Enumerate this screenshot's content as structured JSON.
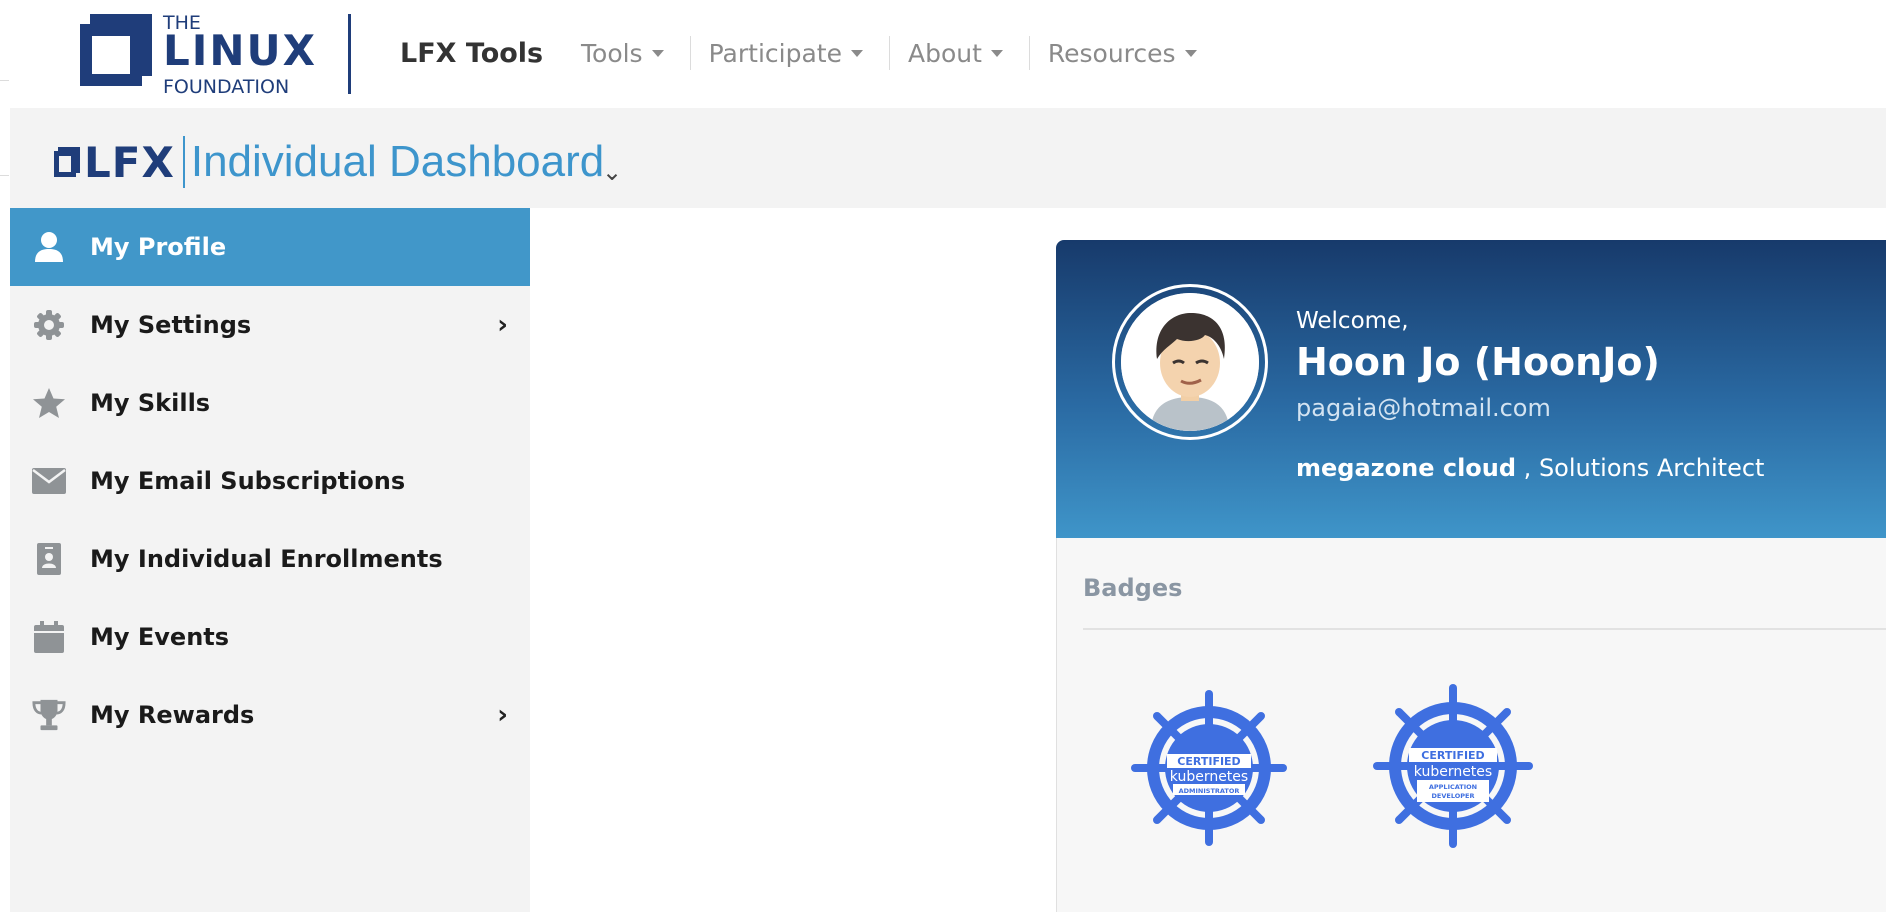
{
  "topnav": {
    "logo": {
      "the": "THE",
      "linux": "LINUX",
      "foundation": "FOUNDATION"
    },
    "product": "LFX Tools",
    "items": [
      {
        "label": "Tools"
      },
      {
        "label": "Participate"
      },
      {
        "label": "About"
      },
      {
        "label": "Resources"
      }
    ]
  },
  "subheader": {
    "brand": "LFX",
    "title": "Individual Dashboard",
    "chevron": "⌄"
  },
  "sidebar": {
    "items": [
      {
        "label": "My Profile",
        "icon": "user-icon",
        "active": true
      },
      {
        "label": "My Settings",
        "icon": "gear-icon",
        "submenu": true
      },
      {
        "label": "My Skills",
        "icon": "star-icon"
      },
      {
        "label": "My Email Subscriptions",
        "icon": "envelope-icon"
      },
      {
        "label": "My Individual Enrollments",
        "icon": "id-badge-icon"
      },
      {
        "label": "My Events",
        "icon": "calendar-icon"
      },
      {
        "label": "My Rewards",
        "icon": "trophy-icon",
        "submenu": true
      }
    ],
    "arrow": "›"
  },
  "profile": {
    "welcome": "Welcome,",
    "name": "Hoon Jo (HoonJo)",
    "email": "pagaia@hotmail.com",
    "organization": "megazone cloud",
    "title_sep": " , ",
    "job_title": "Solutions Architect"
  },
  "badges": {
    "title": "Badges",
    "items": [
      {
        "line1": "CERTIFIED",
        "line2": "kubernetes",
        "line3": "ADMINISTRATOR"
      },
      {
        "line1": "CERTIFIED",
        "line2": "kubernetes",
        "line3": "APPLICATION",
        "line4": "DEVELOPER"
      }
    ]
  },
  "colors": {
    "accent": "#4197c9",
    "brand_navy": "#1f3d7a",
    "badge_blue": "#3f6fe0"
  }
}
